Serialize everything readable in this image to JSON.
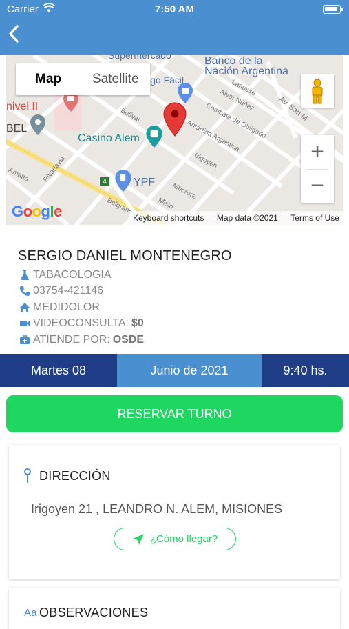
{
  "status_bar": {
    "carrier": "Carrier",
    "time": "7:50 AM"
  },
  "nav": {
    "back_icon": "chevron-left-icon"
  },
  "map": {
    "type_map": "Map",
    "type_satellite": "Satellite",
    "zoom_in": "+",
    "zoom_out": "−",
    "logo": "Google",
    "footer": {
      "shortcuts": "Keyboard shortcuts",
      "data": "Map data ©2021",
      "terms": "Terms of Use"
    },
    "labels": {
      "supermercado": "Supermercado",
      "banco": "Banco de la",
      "banco2": "Nación Argentina",
      "pago_facil": "Pago Fácil",
      "alem_nivel": "nivel II",
      "bel": "BEL",
      "casino": "Casino Alem",
      "ypf": "YPF",
      "route": "4",
      "lanusse": "Lanusse",
      "alvar": "Alvar Núñez",
      "combate": "Combate de Obligado",
      "antartida": "Antártida Argentina",
      "bolivar": "Bolívar",
      "irigoyen": "Irigoyen",
      "mborore": "Mbororé",
      "rivadavia": "Rivadavia",
      "amatta": "Amatta",
      "av_san": "Av. San M",
      "misiones": "Misio",
      "belgrano": "Belgrano"
    }
  },
  "doctor": {
    "name": "SERGIO DANIEL MONTENEGRO",
    "specialty": "TABACOLOGIA",
    "phone": "03754-421146",
    "center": "MEDIDOLOR",
    "video_label": "VIDEOCONSULTA:",
    "video_value": "$0",
    "insurance_label": "ATIENDE POR:",
    "insurance_value": "OSDE"
  },
  "date_bar": {
    "day": "Martes 08",
    "month": "Junio de 2021",
    "time": "9:40 hs."
  },
  "reserve_button": "RESERVAR TURNO",
  "address_card": {
    "title": "DIRECCIÓN",
    "address": "Irigoyen 21 , LEANDRO N. ALEM, MISIONES",
    "how_to": "¿Cómo llegar?"
  },
  "observations_card": {
    "title": "OBSERVACIONES"
  },
  "colors": {
    "header": "#4a8fd0",
    "dark_blue": "#1f3e87",
    "green": "#1ed760",
    "icon_blue": "#4a8fd0"
  }
}
